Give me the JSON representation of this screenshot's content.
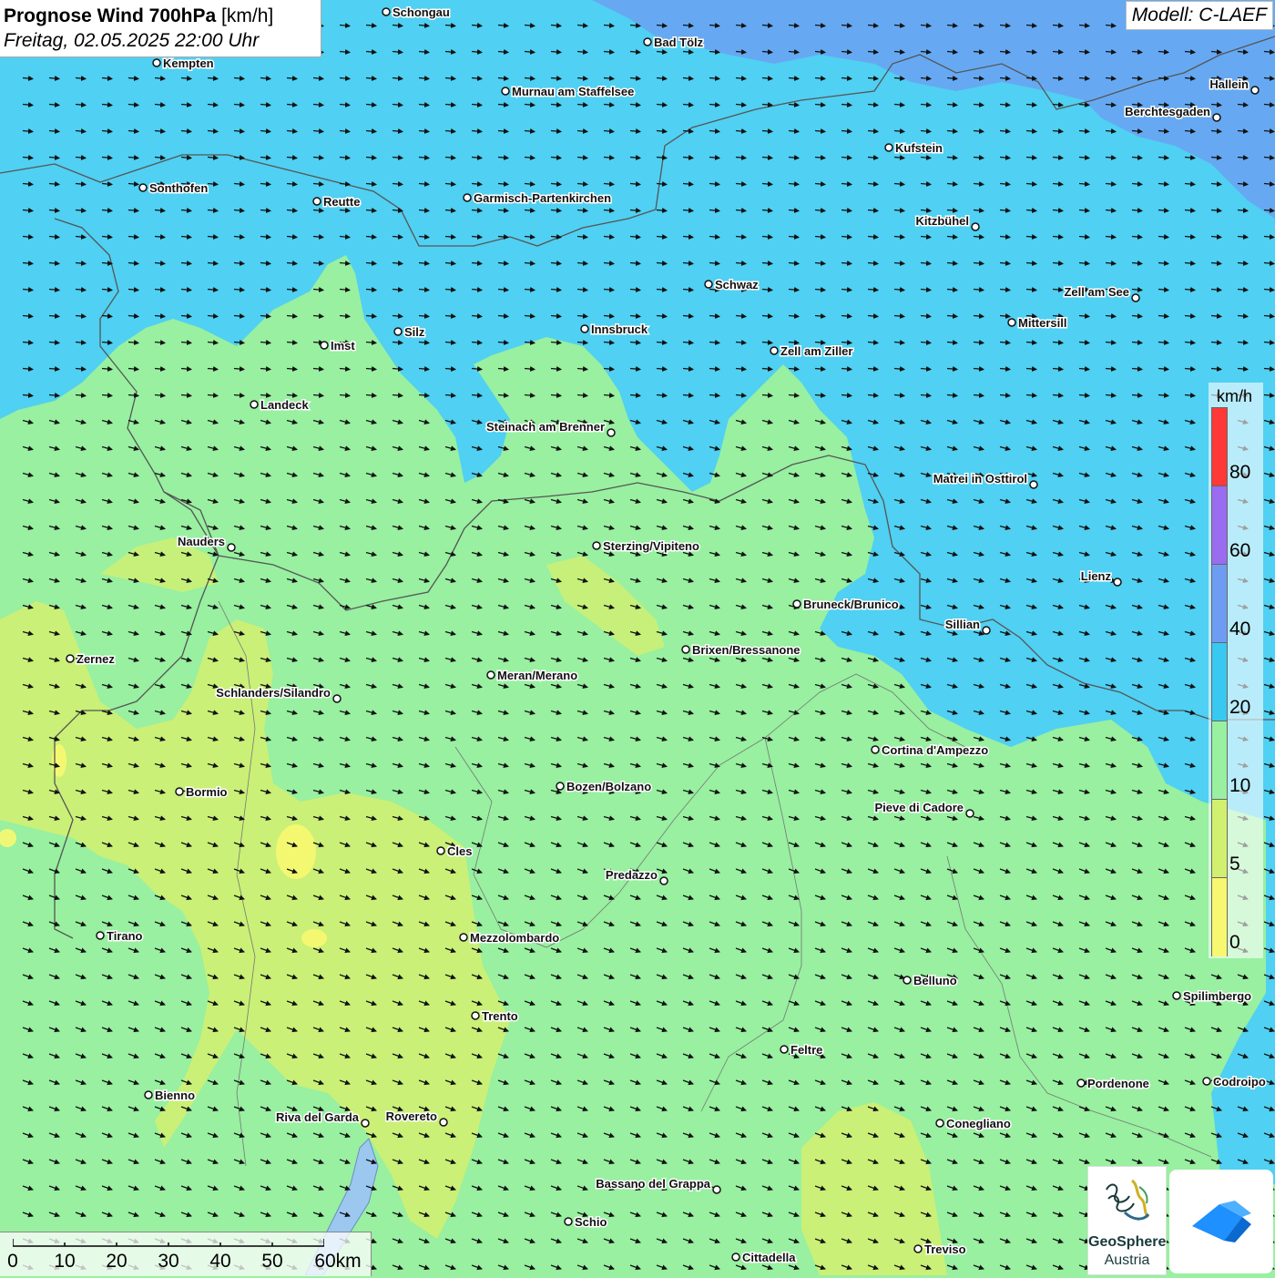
{
  "title": {
    "main": "Prognose Wind 700hPa",
    "unit": "[km/h]",
    "subtitle": "Freitag, 02.05.2025 22:00 Uhr"
  },
  "model": "Modell: C-LAEF",
  "legend": {
    "unit": "km/h",
    "bands": [
      {
        "label": "80",
        "color": "#ff3838"
      },
      {
        "label": "60",
        "color": "#9a6cf0"
      },
      {
        "label": "40",
        "color": "#6e9cf2"
      },
      {
        "label": "20",
        "color": "#38c8f0"
      },
      {
        "label": "10",
        "color": "#98f0a0"
      },
      {
        "label": "5",
        "color": "#d2f070"
      },
      {
        "label": "0",
        "color": "#f8f870"
      }
    ]
  },
  "scale_bar": {
    "labels": [
      "0",
      "10",
      "20",
      "30",
      "40",
      "50",
      "60km"
    ]
  },
  "places": [
    "Schongau",
    "Bad Tölz",
    "Kempten",
    "Murnau am Staffelsee",
    "Hallein",
    "Berchtesgaden",
    "Kufstein",
    "Sonthofen",
    "Reutte",
    "Garmisch-Partenkirchen",
    "Kitzbühel",
    "Schwaz",
    "Zell am See",
    "Mittersill",
    "Innsbruck",
    "Silz",
    "Imst",
    "Zell am Ziller",
    "Landeck",
    "Steinach am Brenner",
    "Matrei in Osttirol",
    "Nauders",
    "Sterzing/Vipiteno",
    "Lienz",
    "Bruneck/Brunico",
    "Sillian",
    "Zernez",
    "Brixen/Bressanone",
    "Meran/Merano",
    "Schlanders/Silandro",
    "Cortina d'Ampezzo",
    "Bormio",
    "Bozen/Bolzano",
    "Pieve di Cadore",
    "Cles",
    "Predazzo",
    "Tirano",
    "Mezzolombardo",
    "Belluno",
    "Spilimbergo",
    "Trento",
    "Feltre",
    "Pordenone",
    "Codroipo",
    "Bienno",
    "Riva del Garda",
    "Rovereto",
    "Conegliano",
    "Bassano del Grappa",
    "Schio",
    "Treviso",
    "Cittadella"
  ],
  "logos": {
    "geosphere_name": "GeoSphere",
    "geosphere_sub": "Austria"
  }
}
